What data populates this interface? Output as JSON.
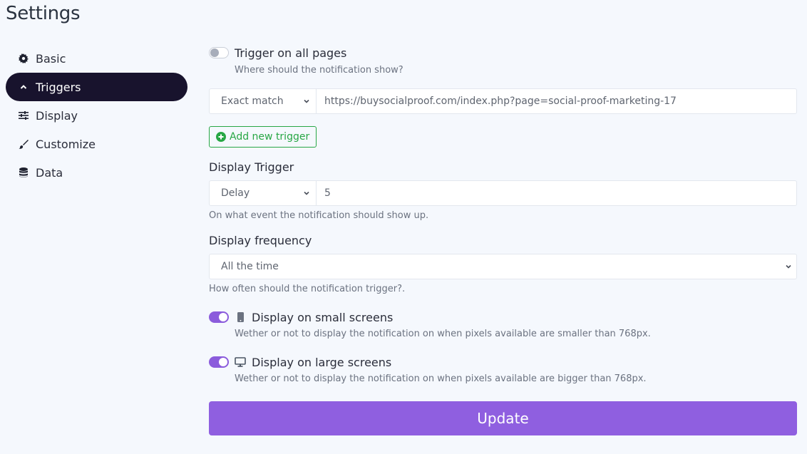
{
  "page": {
    "title": "Settings"
  },
  "sidebar": {
    "items": [
      {
        "label": "Basic",
        "icon": "gear-icon",
        "active": false
      },
      {
        "label": "Triggers",
        "icon": "chevron-up-icon",
        "active": true
      },
      {
        "label": "Display",
        "icon": "sliders-icon",
        "active": false
      },
      {
        "label": "Customize",
        "icon": "paintbrush-icon",
        "active": false
      },
      {
        "label": "Data",
        "icon": "database-icon",
        "active": false
      }
    ]
  },
  "triggers": {
    "all_pages": {
      "label": "Trigger on all pages",
      "enabled": false,
      "help": "Where should the notification show?"
    },
    "rule": {
      "match_type": "Exact match",
      "url": "https://buysocialproof.com/index.php?page=social-proof-marketing-17"
    },
    "add_button": "Add new trigger"
  },
  "display_trigger": {
    "label": "Display Trigger",
    "type": "Delay",
    "value": "5",
    "help": "On what event the notification should show up."
  },
  "display_frequency": {
    "label": "Display frequency",
    "value": "All the time",
    "help": "How often should the notification trigger?."
  },
  "small_screens": {
    "label": "Display on small screens",
    "enabled": true,
    "icon": "mobile-icon",
    "help": "Wether or not to display the notification on when pixels available are smaller than 768px."
  },
  "large_screens": {
    "label": "Display on large screens",
    "enabled": true,
    "icon": "desktop-icon",
    "help": "Wether or not to display the notification on when pixels available are bigger than 768px."
  },
  "actions": {
    "update": "Update"
  },
  "colors": {
    "accent": "#8f5fe0",
    "nav_active": "#18132d",
    "success": "#28a745",
    "background": "#f5f8fd"
  }
}
